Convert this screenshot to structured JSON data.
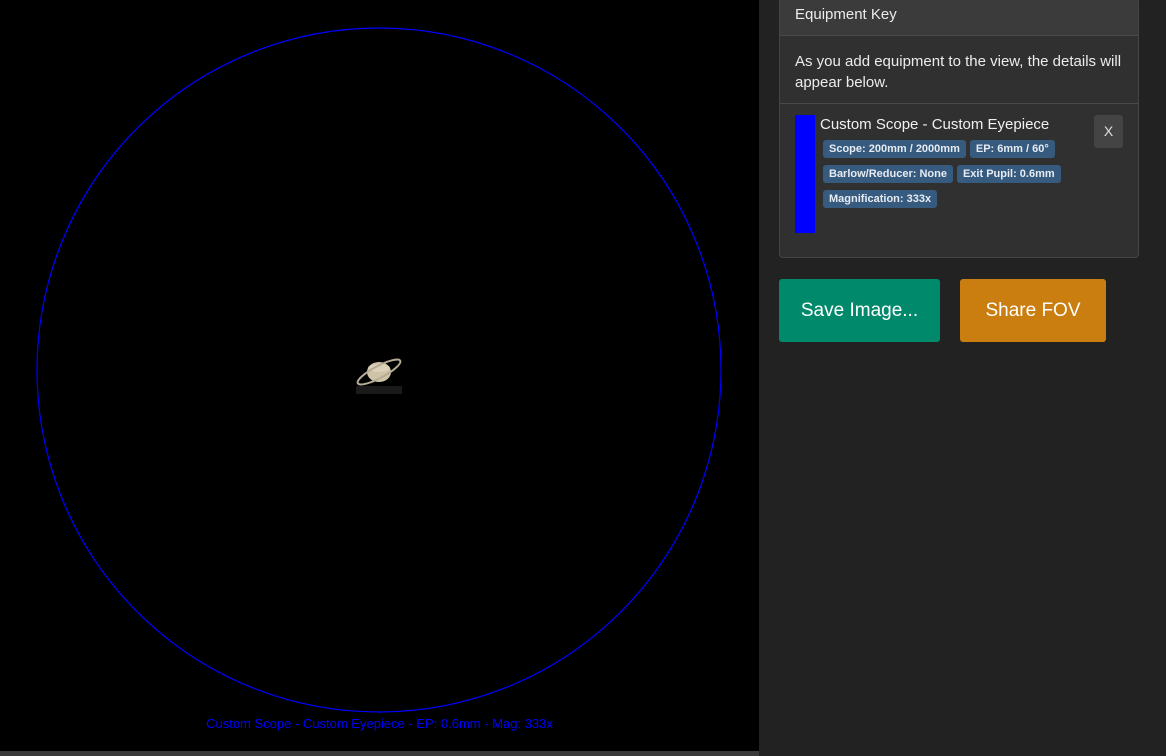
{
  "fov": {
    "caption": "Custom Scope - Custom Eyepiece - EP: 0.6mm - Mag: 333x",
    "circle_color": "#0000ff",
    "object": "saturn"
  },
  "equipment_key": {
    "title": "Equipment Key",
    "intro": "As you add equipment to the view, the details will appear below.",
    "items": [
      {
        "name": "Custom Scope - Custom Eyepiece",
        "color": "#0000ff",
        "badges": [
          "Scope: 200mm / 2000mm",
          "EP: 6mm / 60°",
          "Barlow/Reducer: None",
          "Exit Pupil: 0.6mm",
          "Magnification: 333x"
        ],
        "remove_label": "X"
      }
    ]
  },
  "actions": {
    "save_label": "Save Image...",
    "share_label": "Share FOV"
  },
  "colors": {
    "save": "#00896b",
    "share": "#c97e0f",
    "badge": "#375a7f"
  }
}
